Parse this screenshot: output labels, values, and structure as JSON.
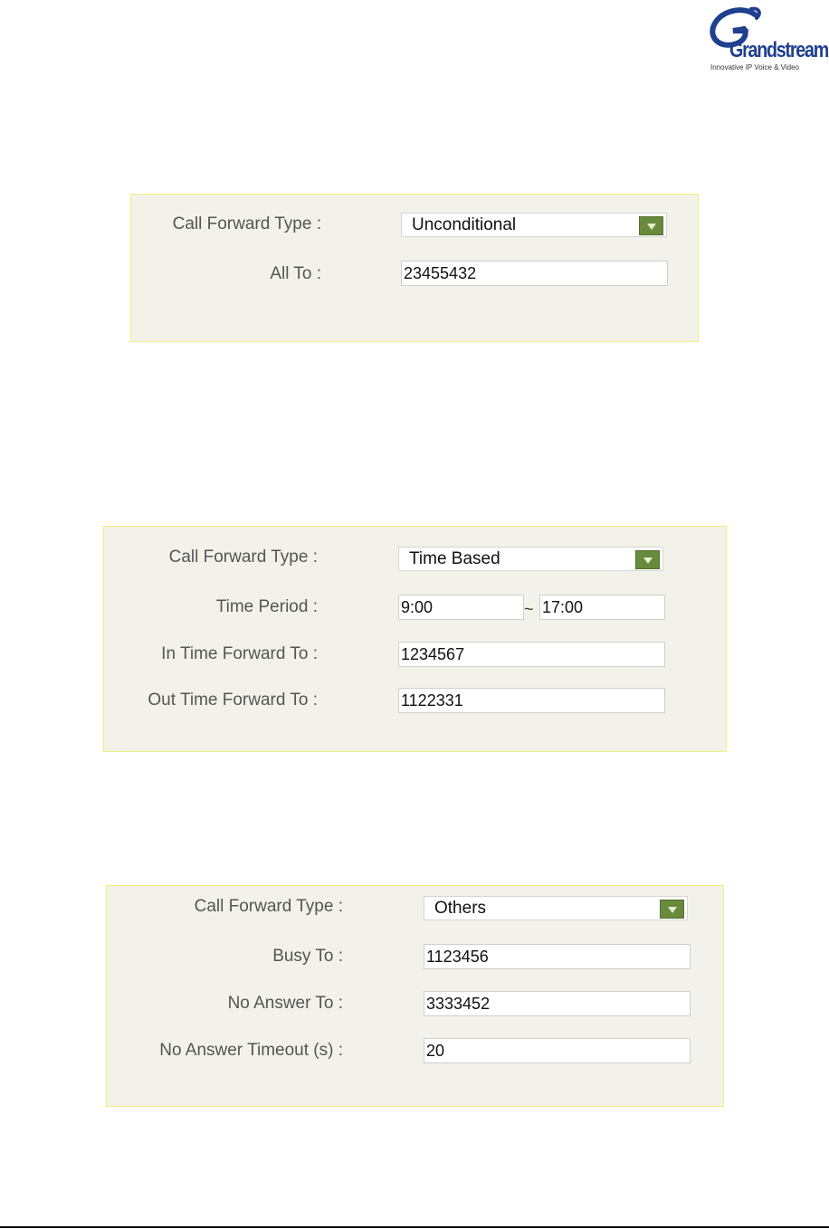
{
  "logo": {
    "wordmark": "Grandstream",
    "tagline": "Innovative IP Voice & Video"
  },
  "panels": {
    "unconditional": {
      "type_label": "Call Forward Type :",
      "type_value": "Unconditional",
      "all_to_label": "All To :",
      "all_to_value": "23455432"
    },
    "time_based": {
      "type_label": "Call Forward Type :",
      "type_value": "Time Based",
      "time_period_label": "Time Period :",
      "time_start": "9:00",
      "time_separator": "~",
      "time_end": "17:00",
      "in_time_label": "In Time Forward To :",
      "in_time_value": "1234567",
      "out_time_label": "Out Time Forward To :",
      "out_time_value": "1122331"
    },
    "others": {
      "type_label": "Call Forward Type :",
      "type_value": "Others",
      "busy_label": "Busy To :",
      "busy_value": "1123456",
      "no_answer_label": "No Answer To :",
      "no_answer_value": "3333452",
      "timeout_label": "No Answer Timeout (s) :",
      "timeout_value": "20"
    }
  },
  "colors": {
    "panel_bg": "#f2f2ea",
    "panel_border": "#f2ef7a",
    "dropdown_arrow": "#688a3c",
    "brand_blue": "#1f3f8f"
  }
}
